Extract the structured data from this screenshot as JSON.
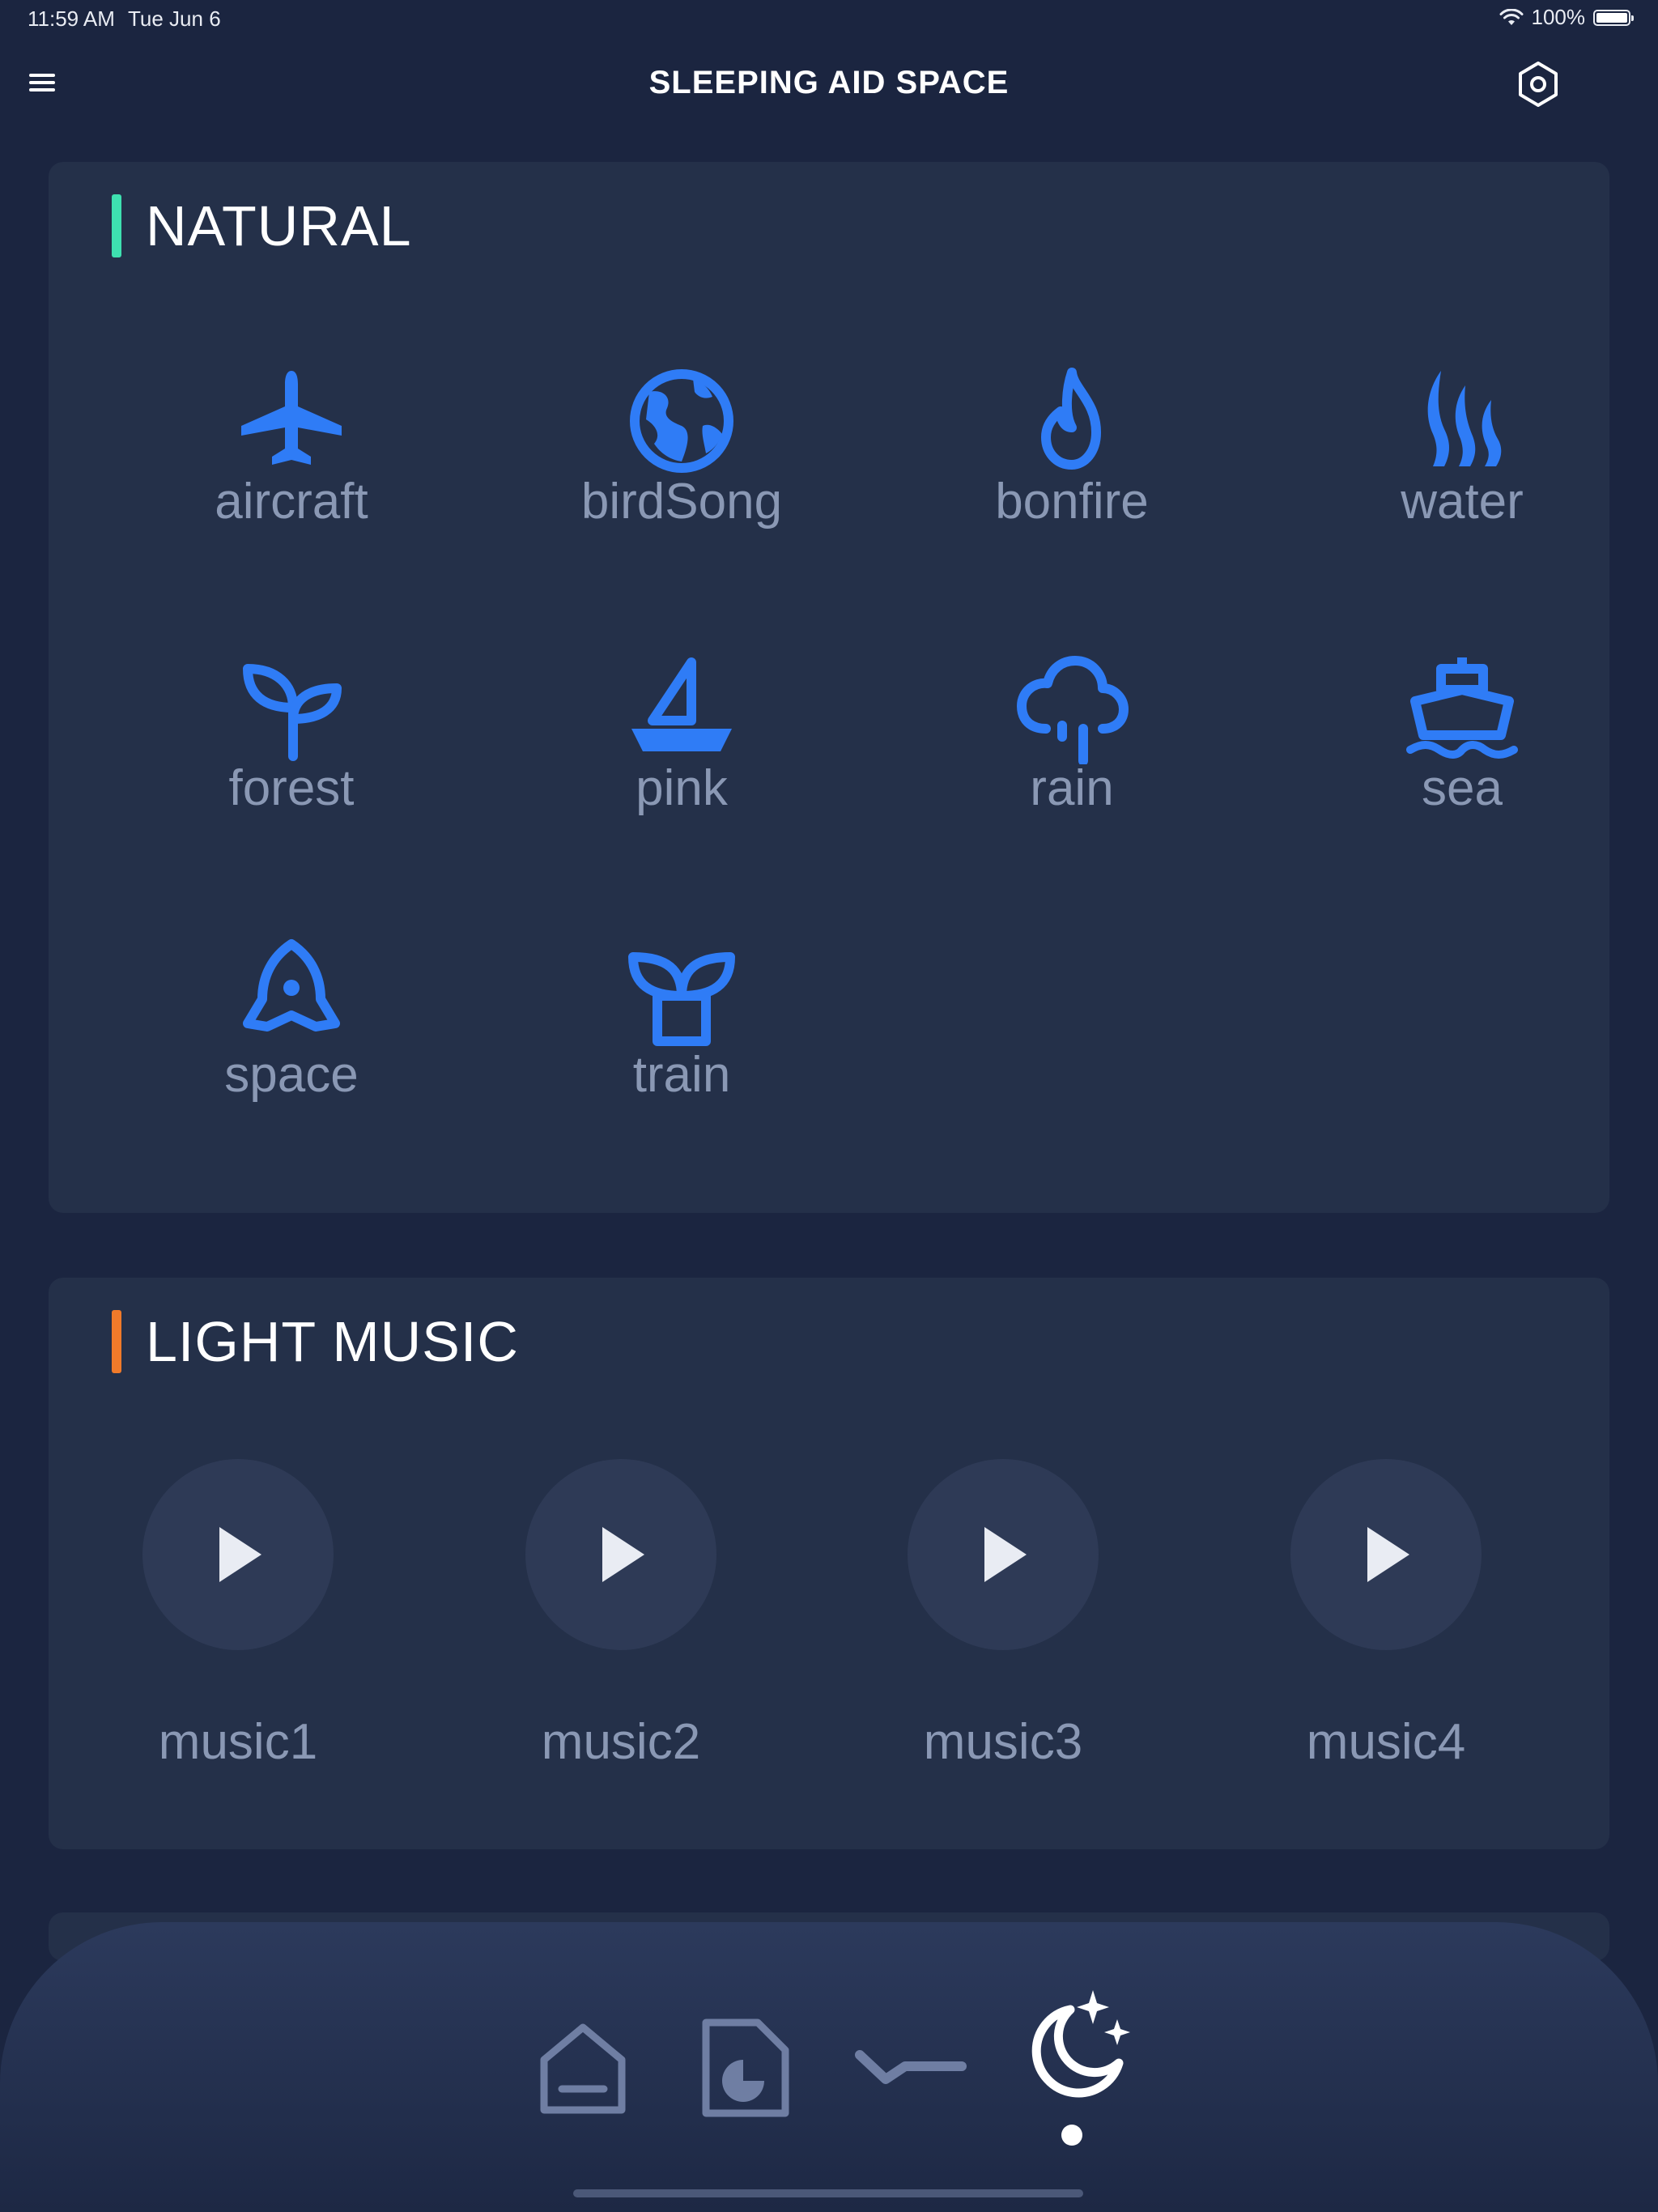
{
  "status_bar": {
    "time": "11:59 AM",
    "date": "Tue Jun 6",
    "battery": "100%"
  },
  "header": {
    "title": "SLEEPING AID SPACE"
  },
  "natural": {
    "title": "NATURAL",
    "accent": "#3ee0b0",
    "icon_color": "#2f7cf6",
    "items": [
      {
        "label": "aircraft",
        "icon": "airplane-icon"
      },
      {
        "label": "birdSong",
        "icon": "globe-icon"
      },
      {
        "label": "bonfire",
        "icon": "flame-icon"
      },
      {
        "label": "water",
        "icon": "waves-flame-icon"
      },
      {
        "label": "forest",
        "icon": "sprout-icon"
      },
      {
        "label": "pink",
        "icon": "sailboat-icon"
      },
      {
        "label": "rain",
        "icon": "rain-cloud-icon"
      },
      {
        "label": "sea",
        "icon": "ship-icon"
      },
      {
        "label": "space",
        "icon": "rocket-icon"
      },
      {
        "label": "train",
        "icon": "potted-plant-icon"
      }
    ]
  },
  "light_music": {
    "title": "LIGHT MUSIC",
    "accent": "#f07a2a",
    "items": [
      {
        "label": "music1"
      },
      {
        "label": "music2"
      },
      {
        "label": "music3"
      },
      {
        "label": "music4"
      }
    ]
  },
  "tab_bar": {
    "tabs": [
      {
        "name": "home-icon",
        "active": false
      },
      {
        "name": "report-icon",
        "active": false
      },
      {
        "name": "sleep-curve-icon",
        "active": false
      },
      {
        "name": "moon-stars-icon",
        "active": true
      }
    ]
  }
}
